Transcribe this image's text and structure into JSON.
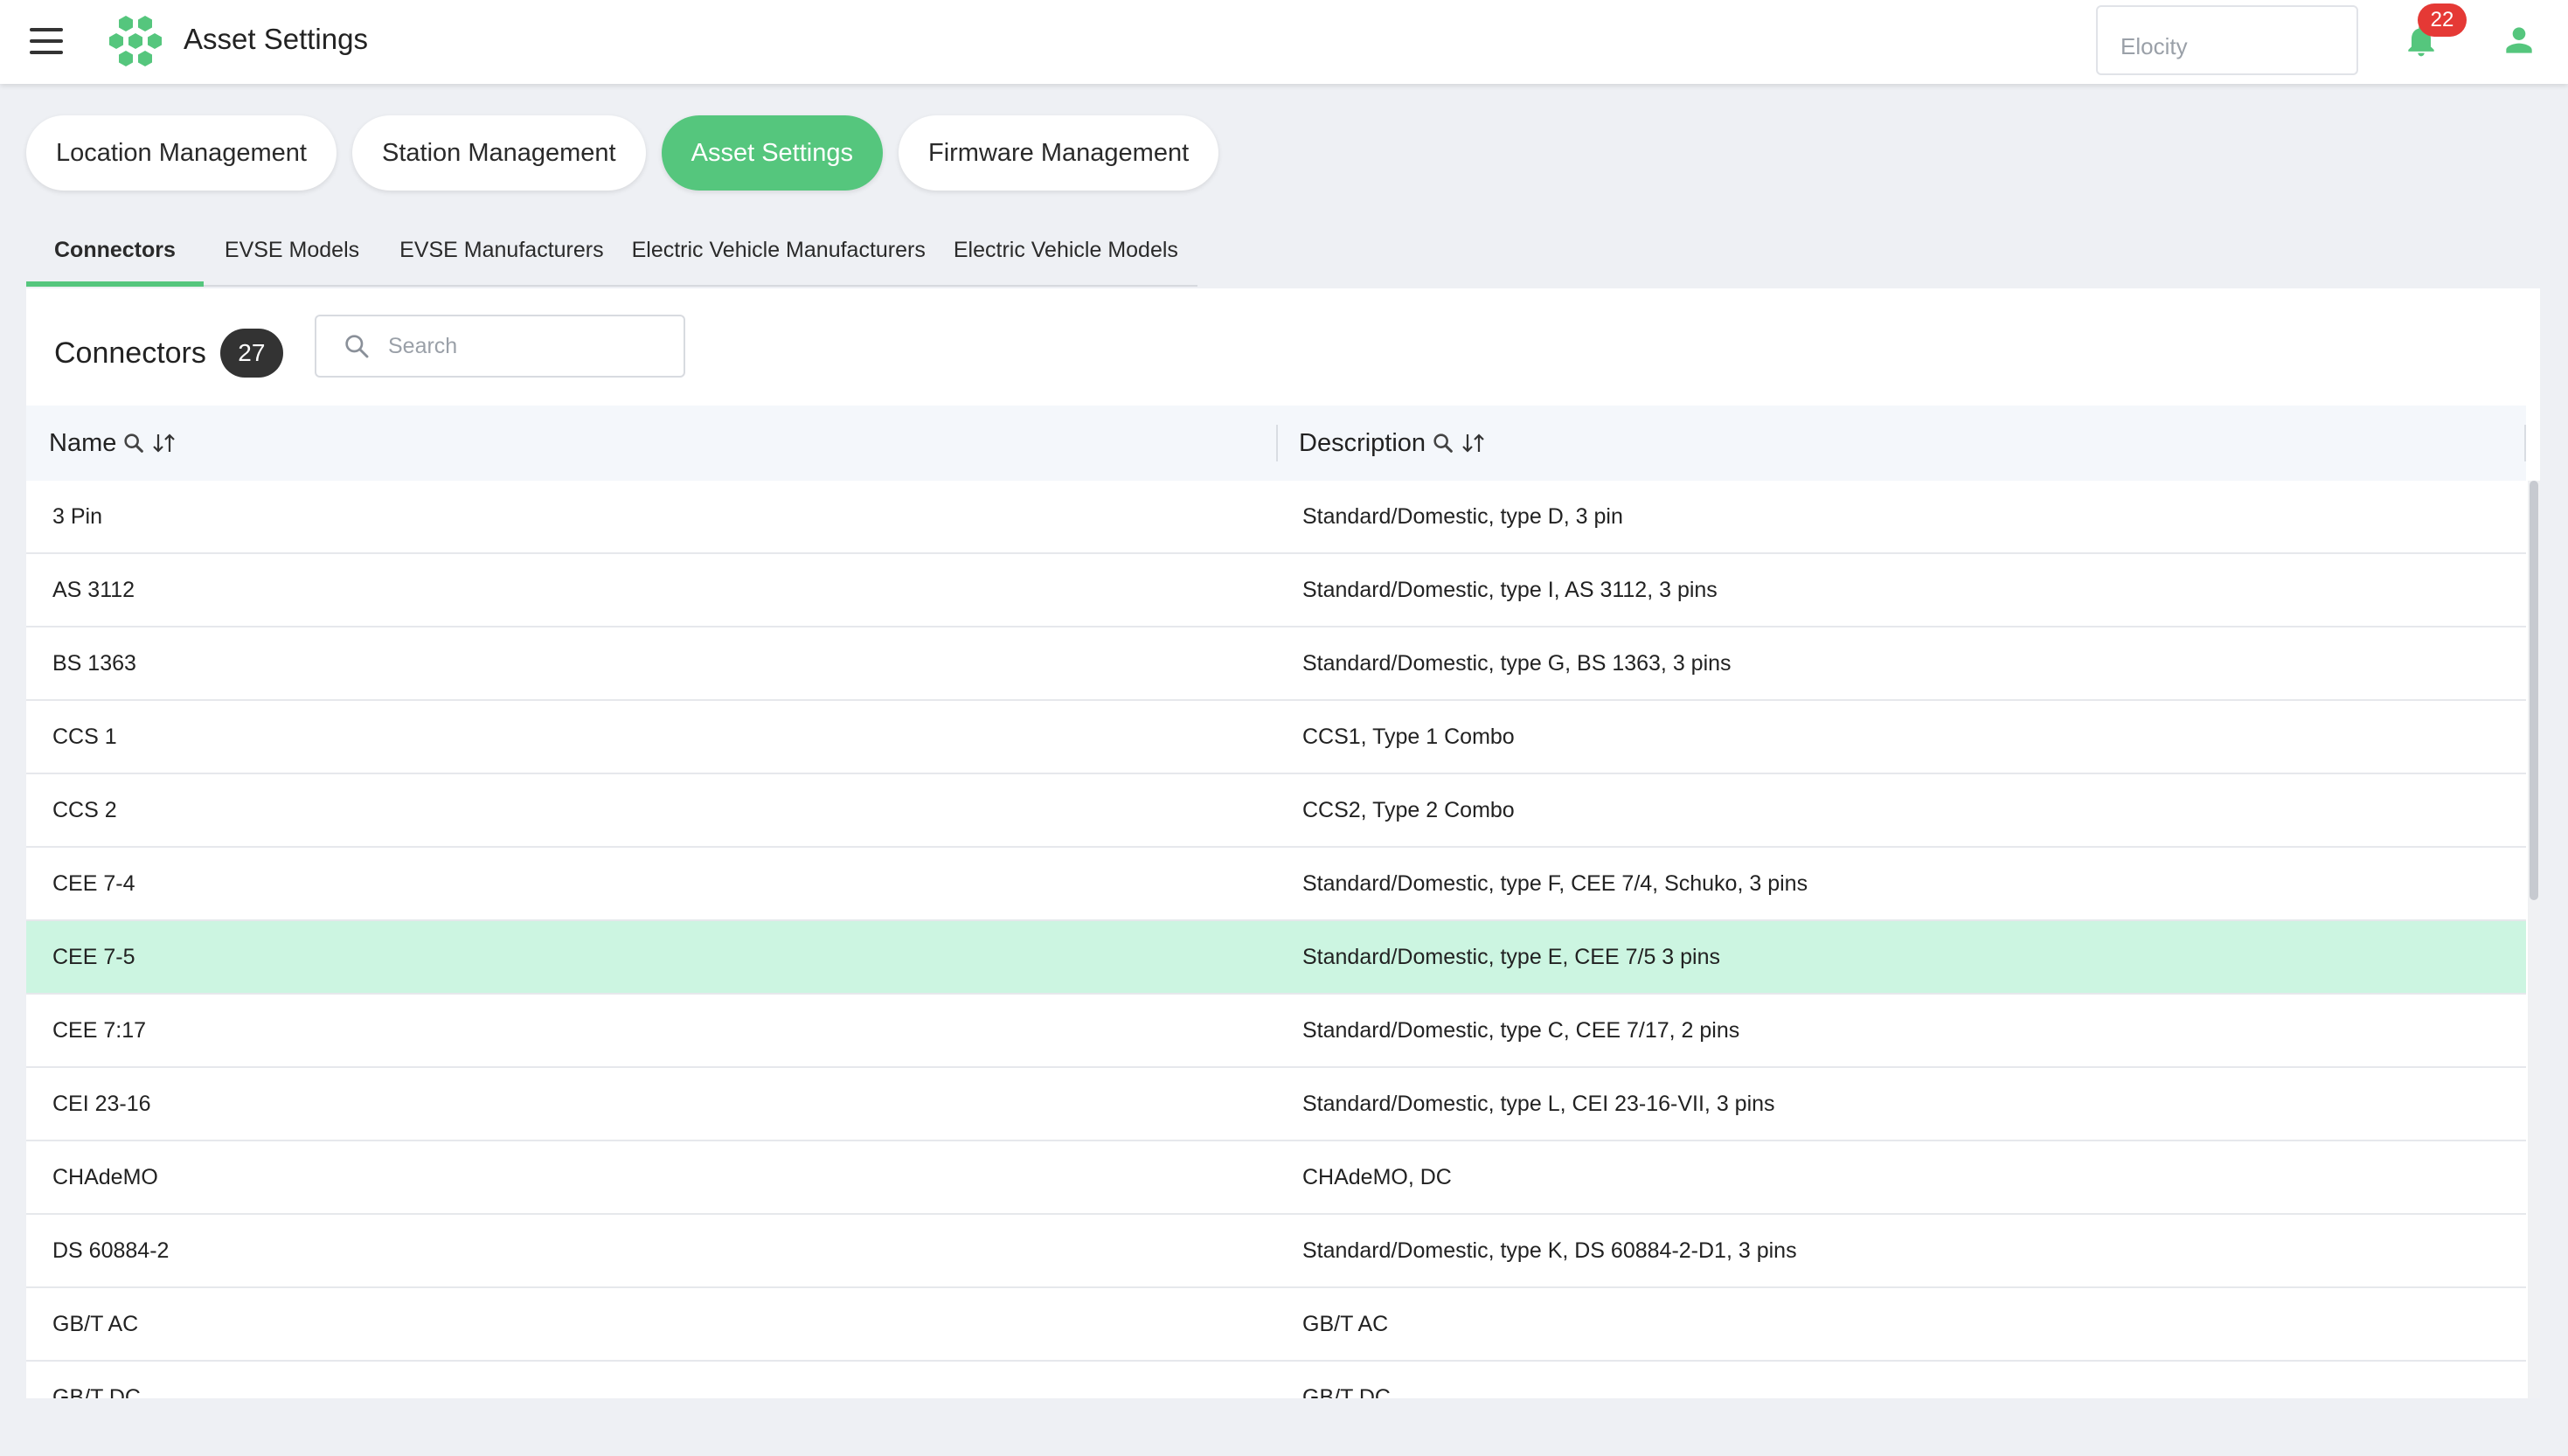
{
  "header": {
    "title": "Asset Settings",
    "tenant": "Elocity",
    "notification_count": "22"
  },
  "modules": [
    {
      "label": "Location Management",
      "active": false
    },
    {
      "label": "Station Management",
      "active": false
    },
    {
      "label": "Asset Settings",
      "active": true
    },
    {
      "label": "Firmware Management",
      "active": false
    }
  ],
  "subtabs": [
    {
      "label": "Connectors",
      "active": true
    },
    {
      "label": "EVSE Models",
      "active": false
    },
    {
      "label": "EVSE Manufacturers",
      "active": false
    },
    {
      "label": "Electric Vehicle Manufacturers",
      "active": false
    },
    {
      "label": "Electric Vehicle Models",
      "active": false
    }
  ],
  "panel": {
    "title": "Connectors",
    "count": "27",
    "search_placeholder": "Search"
  },
  "table": {
    "columns": {
      "name": "Name",
      "description": "Description"
    },
    "rows": [
      {
        "name": "3 Pin",
        "description": "Standard/Domestic, type D, 3 pin",
        "selected": false
      },
      {
        "name": "AS 3112",
        "description": "Standard/Domestic, type I, AS 3112, 3 pins",
        "selected": false
      },
      {
        "name": "BS 1363",
        "description": "Standard/Domestic, type G, BS 1363, 3 pins",
        "selected": false
      },
      {
        "name": "CCS 1",
        "description": "CCS1, Type 1 Combo",
        "selected": false
      },
      {
        "name": "CCS 2",
        "description": "CCS2, Type 2 Combo",
        "selected": false
      },
      {
        "name": "CEE 7-4",
        "description": "Standard/Domestic, type F, CEE 7/4, Schuko, 3 pins",
        "selected": false
      },
      {
        "name": "CEE 7-5",
        "description": "Standard/Domestic, type E, CEE 7/5 3 pins",
        "selected": true
      },
      {
        "name": "CEE 7:17",
        "description": "Standard/Domestic, type C, CEE 7/17, 2 pins",
        "selected": false
      },
      {
        "name": "CEI 23-16",
        "description": "Standard/Domestic, type L, CEI 23-16-VII, 3 pins",
        "selected": false
      },
      {
        "name": "CHAdeMO",
        "description": "CHAdeMO, DC",
        "selected": false
      },
      {
        "name": "DS 60884-2",
        "description": "Standard/Domestic, type K, DS 60884-2-D1, 3 pins",
        "selected": false
      },
      {
        "name": "GB/T AC",
        "description": "GB/T AC",
        "selected": false
      },
      {
        "name": "GB/T DC",
        "description": "GB/T DC",
        "selected": false
      }
    ]
  },
  "icons": {
    "menu": "hamburger-menu-icon",
    "logo": "hexagon-cluster-logo",
    "notifications": "bell-icon",
    "account": "user-icon",
    "search": "search-icon",
    "column_search": "magnifier-icon",
    "column_sort": "sort-arrows-icon"
  },
  "colors": {
    "accent": "#55c67d",
    "selected_row": "#ccf5e1",
    "badge_red": "#e53935",
    "count_badge": "#333333"
  }
}
